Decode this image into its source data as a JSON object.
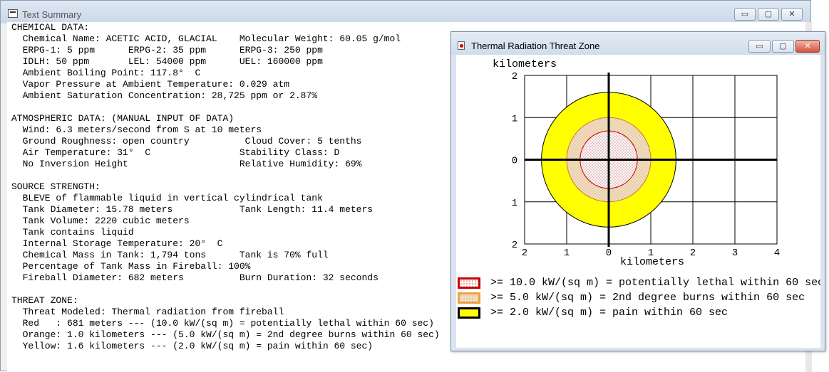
{
  "main_window": {
    "title": "Text Summary",
    "buttons": {
      "minimize": "▭",
      "maximize": "▢",
      "close": "✕"
    }
  },
  "summary_lines": [
    "CHEMICAL DATA:",
    "  Chemical Name: ACETIC ACID, GLACIAL    Molecular Weight: 60.05 g/mol",
    "  ERPG-1: 5 ppm      ERPG-2: 35 ppm      ERPG-3: 250 ppm",
    "  IDLH: 50 ppm       LEL: 54000 ppm      UEL: 160000 ppm",
    "  Ambient Boiling Point: 117.8°  C",
    "  Vapor Pressure at Ambient Temperature: 0.029 atm",
    "  Ambient Saturation Concentration: 28,725 ppm or 2.87%",
    "",
    "ATMOSPHERIC DATA: (MANUAL INPUT OF DATA)",
    "  Wind: 6.3 meters/second from S at 10 meters",
    "  Ground Roughness: open country          Cloud Cover: 5 tenths",
    "  Air Temperature: 31°  C                Stability Class: D",
    "  No Inversion Height                    Relative Humidity: 69%",
    "",
    "SOURCE STRENGTH:",
    "  BLEVE of flammable liquid in vertical cylindrical tank",
    "  Tank Diameter: 15.78 meters            Tank Length: 11.4 meters",
    "  Tank Volume: 2220 cubic meters",
    "  Tank contains liquid",
    "  Internal Storage Temperature: 20°  C",
    "  Chemical Mass in Tank: 1,794 tons      Tank is 70% full",
    "  Percentage of Tank Mass in Fireball: 100%",
    "  Fireball Diameter: 682 meters          Burn Duration: 32 seconds",
    "",
    "THREAT ZONE:",
    "  Threat Modeled: Thermal radiation from fireball",
    "  Red   : 681 meters --- (10.0 kW/(sq m) = potentially lethal within 60 sec)",
    "  Orange: 1.0 kilometers --- (5.0 kW/(sq m) = 2nd degree burns within 60 sec)",
    "  Yellow: 1.6 kilometers --- (2.0 kW/(sq m) = pain within 60 sec)"
  ],
  "threat_window": {
    "title": "Thermal Radiation Threat Zone",
    "buttons": {
      "minimize": "▭",
      "maximize": "▢",
      "close": "✕"
    },
    "y_unit_label": "kilometers",
    "x_unit_label": "kilometers",
    "x_ticks": [
      "2",
      "1",
      "0",
      "1",
      "2",
      "3",
      "4"
    ],
    "y_ticks": [
      "2",
      "1",
      "0",
      "1",
      "2"
    ],
    "x_range_km": [
      -2,
      4
    ],
    "y_range_km": [
      -2,
      2
    ],
    "zones": [
      {
        "level": "red",
        "radius_km": 0.681,
        "color": "#cc0000"
      },
      {
        "level": "orange",
        "radius_km": 1.0,
        "color": "#f0a040"
      },
      {
        "level": "yellow",
        "radius_km": 1.6,
        "color": "#ffff00"
      }
    ],
    "legend": [
      {
        "text": ">= 10.0 kW/(sq m) = potentially lethal within 60 sec",
        "border": "#cc0000",
        "fill": "dotted-white"
      },
      {
        "text": ">= 5.0 kW/(sq m) = 2nd degree burns within 60 sec",
        "border": "#f0a040",
        "fill": "dotted-tan"
      },
      {
        "text": ">= 2.0 kW/(sq m) = pain within 60 sec",
        "border": "#000000",
        "fill": "#ffff00"
      }
    ]
  }
}
